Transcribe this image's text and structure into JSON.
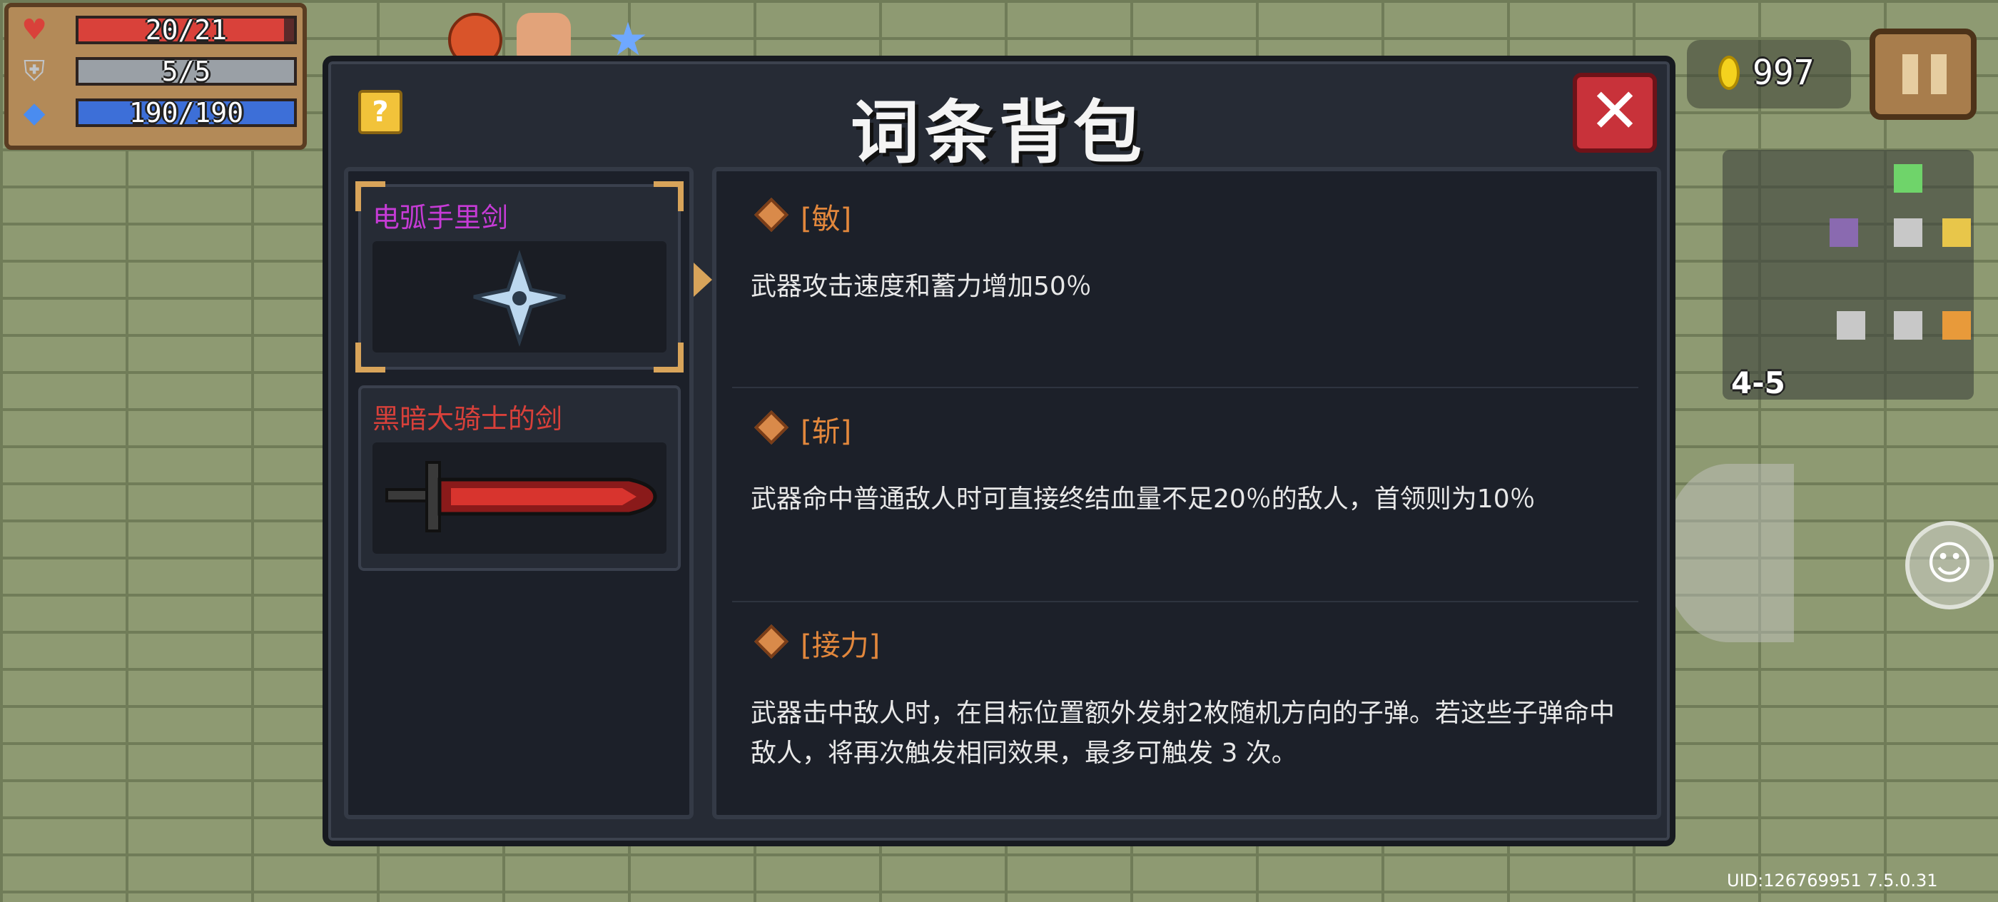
{
  "hud": {
    "hp": "20/21",
    "hp_fill": 0.952,
    "armor": "5/5",
    "armor_fill": 1.0,
    "energy": "190/190",
    "energy_fill": 1.0,
    "coins": "997",
    "level": "4-5",
    "uid": "UID:126769951 7.5.0.31",
    "colors": {
      "hp": "#d9413a",
      "armor": "#9aa0a6",
      "energy": "#3d6fd8"
    }
  },
  "modal": {
    "title": "词条背包",
    "help_label": "?",
    "close_label": "✕"
  },
  "items": [
    {
      "name": "电弧手里剑",
      "color": "#c63bd6",
      "selected": true,
      "icon": "shuriken-icon"
    },
    {
      "name": "黑暗大骑士的剑",
      "color": "#d8403a",
      "selected": false,
      "icon": "dark-sword-icon"
    }
  ],
  "affixes": [
    {
      "name": "[敏]",
      "desc": "武器攻击速度和蓄力增加50％"
    },
    {
      "name": "[斩]",
      "desc": "武器命中普通敌人时可直接终结血量不足20％的敌人，首领则为10％"
    },
    {
      "name": "[接力]",
      "desc": "武器击中敌人时，在目标位置额外发射2枚随机方向的子弹。若这些子弹命中敌人，将再次触发相同效果，最多可触发 3 次。"
    }
  ]
}
